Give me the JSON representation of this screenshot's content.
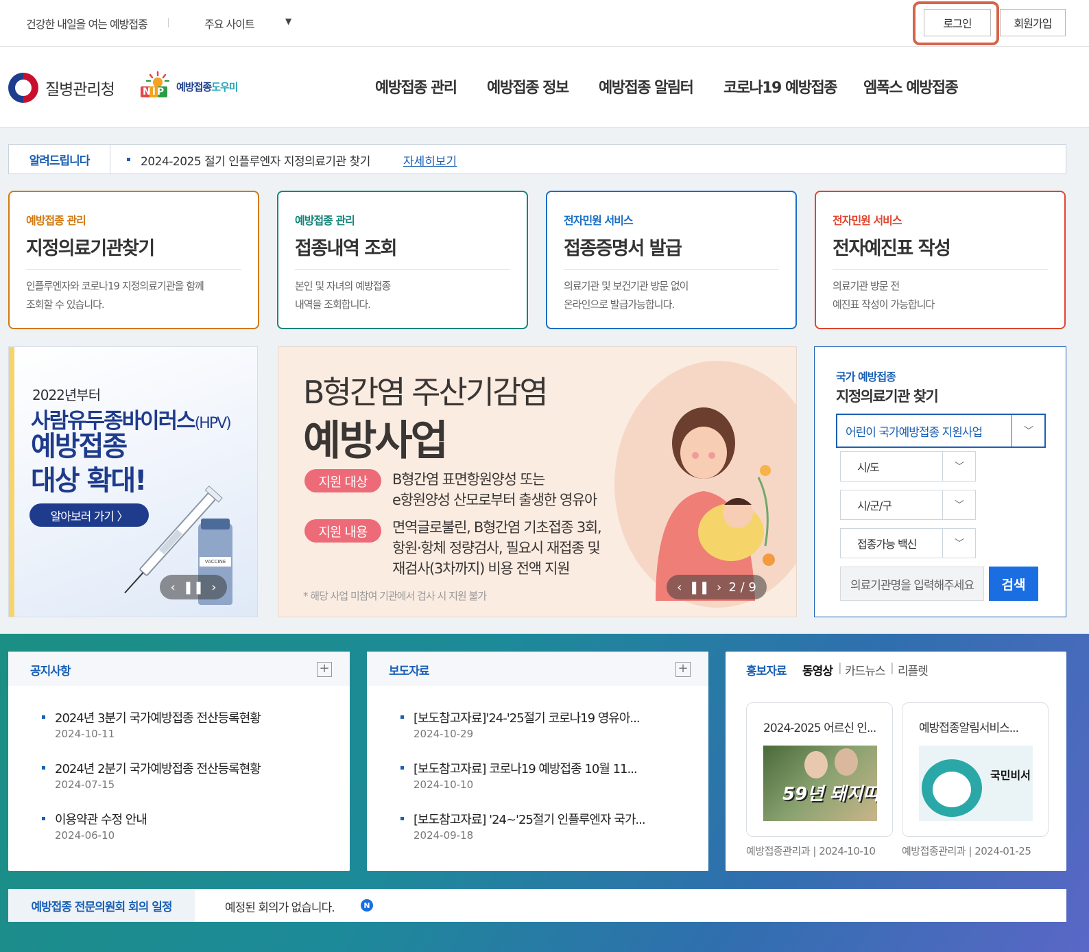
{
  "topbar": {
    "slogan": "건강한 내일을 여는 예방접종",
    "sites": "주요 사이트",
    "login": "로그인",
    "join": "회원가입"
  },
  "header": {
    "kdca": "질병관리청",
    "nip_mark": "NIP",
    "nip_label_a": "예방접종",
    "nip_label_b": "도우미",
    "nav": [
      "예방접종 관리",
      "예방접종 정보",
      "예방접종 알림터",
      "코로나19 예방접종",
      "엠폭스 예방접종"
    ]
  },
  "notice": {
    "label": "알려드립니다",
    "text": "2024-2025 절기 인플루엔자 지정의료기관 찾기",
    "more": "자세히보기"
  },
  "services": [
    {
      "cat": "예방접종 관리",
      "title": "지정의료기관찾기",
      "desc1": "인플루엔자와 코로나19 지정의료기관을 함께",
      "desc2": "조회할 수 있습니다.",
      "color": "#d07a14"
    },
    {
      "cat": "예방접종 관리",
      "title": "접종내역 조회",
      "desc1": "본인 및 자녀의 예방접종",
      "desc2": "내역을 조회합니다.",
      "color": "#17857a"
    },
    {
      "cat": "전자민원 서비스",
      "title": "접종증명서 발급",
      "desc1": "의료기관 및 보건기관 방문 없이",
      "desc2": "온라인으로 발급가능합니다.",
      "color": "#1a6ec4"
    },
    {
      "cat": "전자민원 서비스",
      "title": "전자예진표 작성",
      "desc1": "의료기관 방문 전",
      "desc2": "예진표 작성이 가능합니다",
      "color": "#e0452e"
    }
  ],
  "banner_left": {
    "year": "2022년부터",
    "hpv": "사람유두종바이러스",
    "hpv_abbr": "(HPV)",
    "big1": "예방접종",
    "big2": "대상 확대!",
    "button": "알아보러 가기 〉",
    "vial_label": "VACCINE"
  },
  "banner_mid": {
    "title1": "B형간염 주산기감염",
    "title2": "예방사업",
    "tag1": "지원 대상",
    "text1a": "B형간염 표면항원양성 또는",
    "text1b": "e항원양성 산모로부터 출생한 영유아",
    "tag2": "지원 내용",
    "text2a": "면역글로불린, B형간염 기초접종 3회,",
    "text2b": "항원·항체 정량검사, 필요시 재접종 및",
    "text2c": "재검사(3차까지) 비용 전액 지원",
    "note": "* 해당 사업 미참여 기관에서 검사 시 지원 불가",
    "counter": "2 / 9"
  },
  "finder": {
    "cat": "국가 예방접종",
    "title": "지정의료기관 찾기",
    "program": "어린이 국가예방접종 지원사업",
    "sido": "시/도",
    "sigungu": "시/군/구",
    "vaccine": "접종가능 백신",
    "placeholder": "의료기관명을 입력해주세요",
    "search": "검색"
  },
  "notices_board": {
    "title": "공지사항",
    "items": [
      {
        "text": "2024년 3분기 국가예방접종 전산등록현황",
        "date": "2024-10-11"
      },
      {
        "text": "2024년 2분기 국가예방접종 전산등록현황",
        "date": "2024-07-15"
      },
      {
        "text": "이용약관 수정 안내",
        "date": "2024-06-10"
      }
    ]
  },
  "press_board": {
    "title": "보도자료",
    "items": [
      {
        "text": "[보도참고자료]'24-'25절기 코로나19 영유아...",
        "date": "2024-10-29"
      },
      {
        "text": "[보도참고자료] 코로나19 예방접종 10월 11...",
        "date": "2024-10-10"
      },
      {
        "text": "[보도참고자료] '24~'25절기 인플루엔자 국가...",
        "date": "2024-09-18"
      }
    ]
  },
  "promo": {
    "title": "홍보자료",
    "tab_video": "동영상",
    "tab_card": "카드뉴스",
    "tab_leaflet": "리플렛",
    "cards": [
      {
        "title": "2024-2025 어르신 인...",
        "thumb_text": "59년 돼지띠",
        "meta": "예방접종관리과 | 2024-10-10"
      },
      {
        "title": "예방접종알림서비스...",
        "thumb_text": "국민비서",
        "meta": "예방접종관리과 | 2024-01-25"
      }
    ]
  },
  "meeting": {
    "label": "예방접종 전문의원회 회의 일정",
    "text": "예정된 회의가 없습니다.",
    "badge": "N"
  }
}
